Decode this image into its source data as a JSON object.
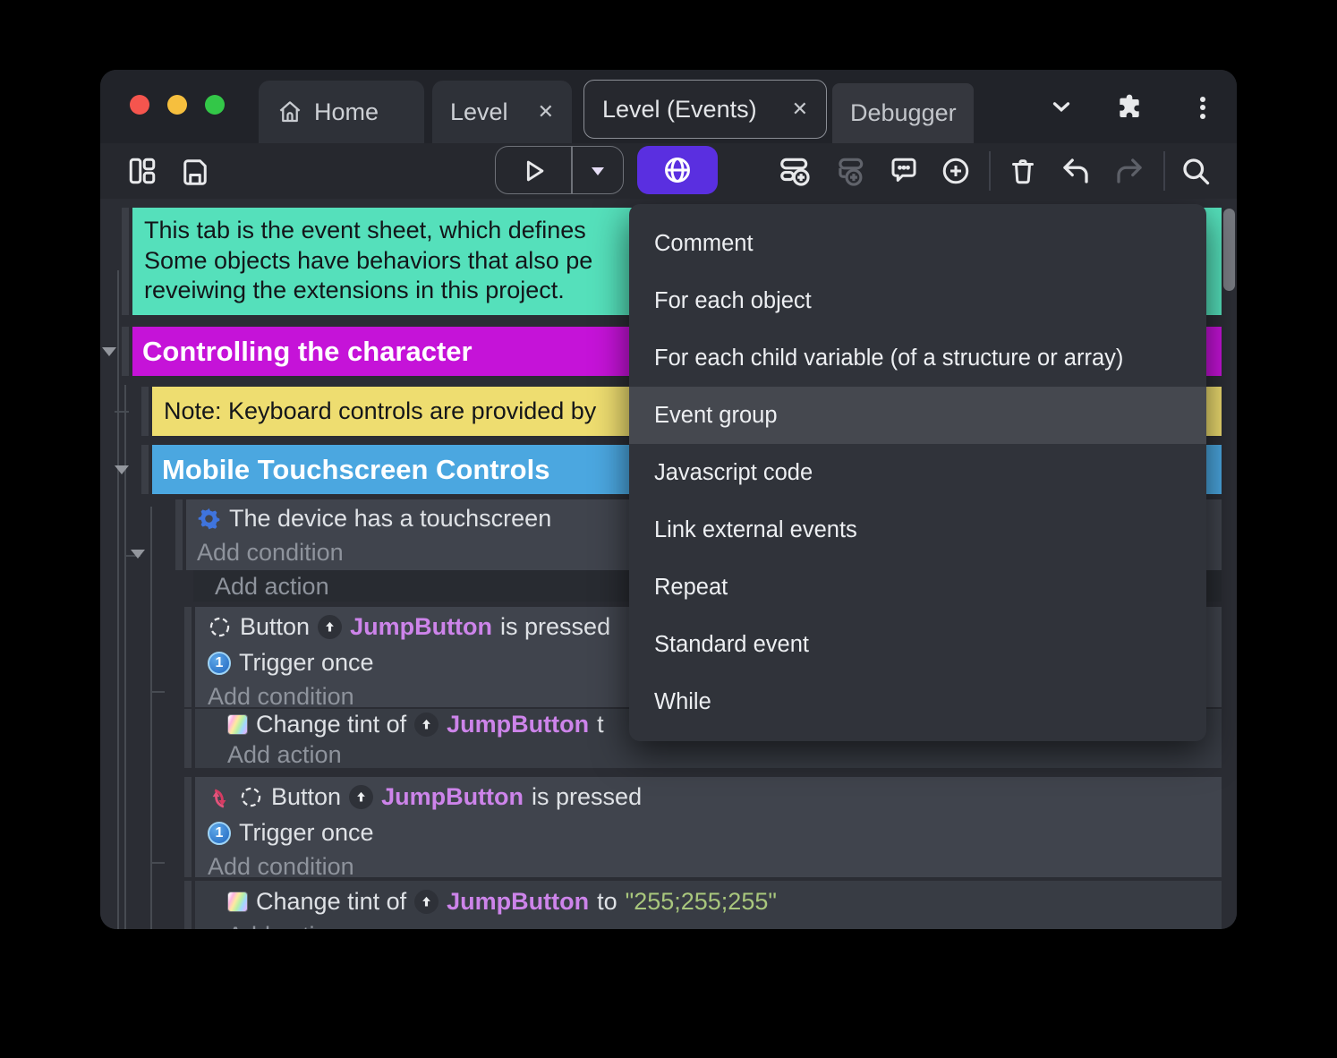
{
  "window": {
    "traffic_lights": [
      "close",
      "minimize",
      "zoom"
    ],
    "tabs": {
      "home": {
        "label": "Home"
      },
      "level": {
        "label": "Level",
        "close": "✕"
      },
      "level_events": {
        "label": "Level (Events)",
        "close": "✕"
      },
      "debugger": {
        "label": "Debugger"
      }
    },
    "titlebar_icons": [
      "chevron-down",
      "extensions-puzzle",
      "kebab-menu"
    ]
  },
  "toolbar": {
    "icons": [
      "layout",
      "save",
      "play",
      "play-dropdown",
      "preview-globe",
      "add-event",
      "add-sub-event",
      "add-comment",
      "add-circle",
      "delete",
      "undo",
      "redo",
      "search"
    ],
    "accent_color": "#5a2fe0"
  },
  "context_menu": {
    "items": [
      {
        "label": "Comment"
      },
      {
        "label": "For each object"
      },
      {
        "label": "For each child variable (of a structure or array)"
      },
      {
        "label": "Event group",
        "highlighted": true
      },
      {
        "label": "Javascript code"
      },
      {
        "label": "Link external events"
      },
      {
        "label": "Repeat"
      },
      {
        "label": "Standard event"
      },
      {
        "label": "While"
      }
    ]
  },
  "labels": {
    "add_condition": "Add condition",
    "add_action": "Add action"
  },
  "event_sheet": {
    "comment": {
      "color": "#55e0bb",
      "lines": [
        "This tab is the event sheet, which defines",
        "Some objects have behaviors that also pe",
        "reveiwing the extensions in this project."
      ]
    },
    "group_controlling": {
      "label": "Controlling the character",
      "color": "#c513d8"
    },
    "note": {
      "text": "Note: Keyboard controls are provided by",
      "color": "#eedd70"
    },
    "group_mobile": {
      "label": "Mobile Touchscreen Controls",
      "color": "#4ba7e0"
    },
    "touch_event": {
      "condition": "The device has a touchscreen"
    },
    "button_event_1": {
      "plugin": "Button",
      "object": "JumpButton",
      "suffix": "is pressed",
      "trigger": "Trigger once"
    },
    "tint_action_1": {
      "prefix": "Change tint of",
      "object": "JumpButton",
      "suffix": "t"
    },
    "button_event_2": {
      "plugin": "Button",
      "object": "JumpButton",
      "suffix": "is pressed",
      "trigger": "Trigger once",
      "inverted_marker": "inverted"
    },
    "tint_action_2": {
      "prefix": "Change tint of",
      "object": "JumpButton",
      "to": "to",
      "value": "\"255;255;255\""
    },
    "object_name_color": "#cd84ea",
    "string_color": "#a9c77d"
  }
}
